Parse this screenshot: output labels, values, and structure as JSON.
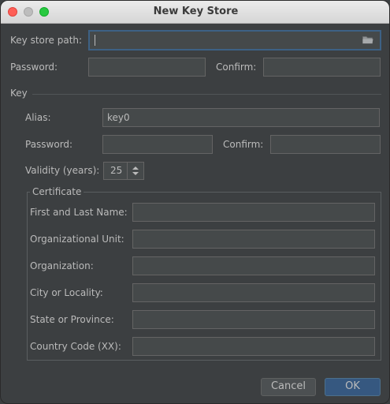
{
  "window": {
    "title": "New Key Store"
  },
  "keystore": {
    "path_label": "Key store path:",
    "path_value": "",
    "password_label": "Password:",
    "confirm_label": "Confirm:"
  },
  "key": {
    "section_label": "Key",
    "alias_label": "Alias:",
    "alias_value": "key0",
    "password_label": "Password:",
    "confirm_label": "Confirm:",
    "validity_label": "Validity (years):",
    "validity_value": "25"
  },
  "certificate": {
    "group_label": "Certificate",
    "fields": [
      {
        "label": "First and Last Name:",
        "value": ""
      },
      {
        "label": "Organizational Unit:",
        "value": ""
      },
      {
        "label": "Organization:",
        "value": ""
      },
      {
        "label": "City or Locality:",
        "value": ""
      },
      {
        "label": "State or Province:",
        "value": ""
      },
      {
        "label": "Country Code (XX):",
        "value": ""
      }
    ]
  },
  "buttons": {
    "cancel": "Cancel",
    "ok": "OK"
  },
  "icons": {
    "browse": "folder-icon",
    "spinner": "up-down-arrows-icon"
  },
  "colors": {
    "background": "#3c3f41",
    "field": "#45494a",
    "focus_border": "#3d6185",
    "ok_button": "#365880"
  }
}
